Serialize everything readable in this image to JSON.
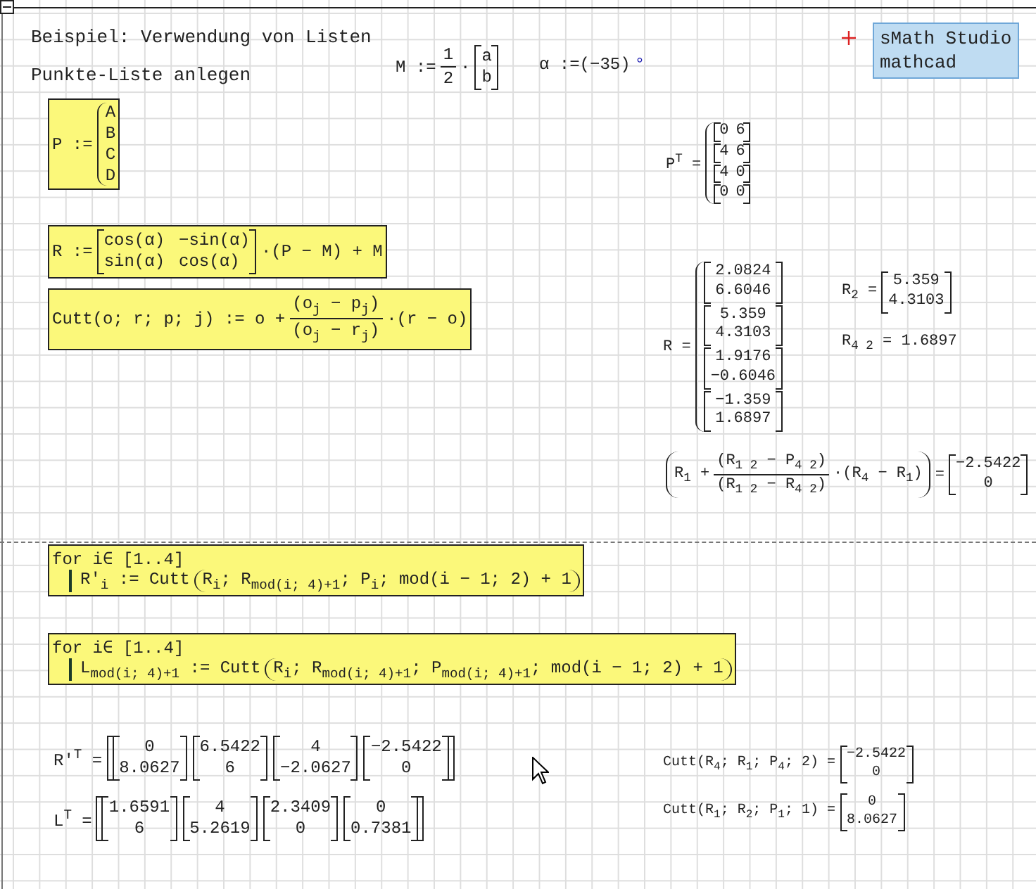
{
  "titles": [
    {
      "text": "Beispiel: Verwendung von Listen"
    },
    {
      "text": "Punkte-Liste anlegen"
    }
  ],
  "label_box": {
    "lines": [
      "sMath Studio",
      "mathcad"
    ]
  },
  "regions": [
    {
      "kind": "expr",
      "highlighted": false,
      "parts": [
        {
          "kind": "text",
          "text": "M :="
        },
        {
          "kind": "frac",
          "num": "1",
          "den": "2"
        },
        {
          "kind": "text",
          "text": "·"
        },
        {
          "kind": "vector",
          "entries": [
            "a",
            "b"
          ]
        }
      ]
    },
    {
      "kind": "expr",
      "highlighted": false,
      "parts": [
        {
          "kind": "text",
          "text": "α :=(−35)"
        },
        {
          "kind": "unit",
          "text": "°"
        }
      ]
    },
    {
      "kind": "expr",
      "highlighted": true,
      "parts": [
        {
          "kind": "text",
          "text": "P :="
        },
        {
          "kind": "brace",
          "items": [
            {
              "kind": "text",
              "text": "A"
            },
            {
              "kind": "text",
              "text": "B"
            },
            {
              "kind": "text",
              "text": "C"
            },
            {
              "kind": "text",
              "text": "D"
            }
          ]
        }
      ]
    },
    {
      "kind": "expr",
      "highlighted": false,
      "parts": [
        {
          "kind": "text",
          "text": "P$^{T}$ ="
        },
        {
          "kind": "brace",
          "items": [
            {
              "kind": "row",
              "entries": [
                "0",
                "6"
              ]
            },
            {
              "kind": "row",
              "entries": [
                "4",
                "6"
              ]
            },
            {
              "kind": "row",
              "entries": [
                "4",
                "0"
              ]
            },
            {
              "kind": "row",
              "entries": [
                "0",
                "0"
              ]
            }
          ]
        }
      ]
    },
    {
      "kind": "expr",
      "highlighted": true,
      "parts": [
        {
          "kind": "text",
          "text": "R :="
        },
        {
          "kind": "matrix",
          "rows": [
            [
              "cos(α)",
              "−sin(α)"
            ],
            [
              "sin(α)",
              "cos(α)"
            ]
          ]
        },
        {
          "kind": "text",
          "text": "·(P − M) + M"
        }
      ]
    },
    {
      "kind": "expr",
      "highlighted": true,
      "parts": [
        {
          "kind": "text",
          "text": "Cutt(o; r; p; j) := o +"
        },
        {
          "kind": "frac",
          "num": "(o$_{j}$ − p$_{j}$)",
          "den": "(o$_{j}$ − r$_{j}$)"
        },
        {
          "kind": "text",
          "text": "·(r − o)"
        }
      ]
    },
    {
      "kind": "expr",
      "highlighted": false,
      "parts": [
        {
          "kind": "text",
          "text": "R ="
        },
        {
          "kind": "brace",
          "items": [
            {
              "kind": "vector",
              "entries": [
                "2.0824",
                "6.6046"
              ]
            },
            {
              "kind": "vector",
              "entries": [
                "5.359",
                "4.3103"
              ]
            },
            {
              "kind": "vector",
              "entries": [
                "1.9176",
                "−0.6046"
              ]
            },
            {
              "kind": "vector",
              "entries": [
                "−1.359",
                "1.6897"
              ]
            }
          ]
        }
      ]
    },
    {
      "kind": "expr",
      "highlighted": false,
      "parts": [
        {
          "kind": "text",
          "text": "R$_{2}$ ="
        },
        {
          "kind": "vector",
          "entries": [
            "5.359",
            "4.3103"
          ]
        }
      ]
    },
    {
      "kind": "expr",
      "highlighted": false,
      "parts": [
        {
          "kind": "text",
          "text": "R$_{4 2}$ = 1.6897"
        }
      ]
    },
    {
      "kind": "expr",
      "highlighted": false,
      "parts": [
        {
          "kind": "paren",
          "parts": [
            {
              "kind": "text",
              "text": "R$_{1}$ +"
            },
            {
              "kind": "frac",
              "num": "(R$_{1 2}$ − P$_{4 2}$)",
              "den": "(R$_{1 2}$ − R$_{4 2}$)"
            },
            {
              "kind": "text",
              "text": "·(R$_{4}$ − R$_{1}$)"
            }
          ]
        },
        {
          "kind": "text",
          "text": "="
        },
        {
          "kind": "vector",
          "entries": [
            "−2.5422",
            "0"
          ]
        }
      ]
    },
    {
      "kind": "loop",
      "highlighted": true,
      "header": "for i∈ [1..4]",
      "body": [
        {
          "kind": "text",
          "text": "R'$_{i}$ := Cutt"
        },
        {
          "kind": "paren",
          "parts": [
            {
              "kind": "text",
              "text": "R$_{i}$; R$_{mod(i; 4)+1}$; P$_{i}$; mod(i − 1; 2) + 1"
            }
          ]
        }
      ]
    },
    {
      "kind": "loop",
      "highlighted": true,
      "header": "for i∈ [1..4]",
      "body": [
        {
          "kind": "text",
          "text": "L$_{mod(i; 4)+1}$ := Cutt"
        },
        {
          "kind": "paren",
          "parts": [
            {
              "kind": "text",
              "text": "R$_{i}$; R$_{mod(i; 4)+1}$; P$_{mod(i; 4)+1}$; mod(i − 1; 2) + 1"
            }
          ]
        }
      ]
    },
    {
      "kind": "expr",
      "highlighted": false,
      "parts": [
        {
          "kind": "text",
          "text": "R'$^{T}$ ="
        },
        {
          "kind": "bracket",
          "parts": [
            {
              "kind": "vector",
              "entries": [
                "0",
                "8.0627"
              ]
            },
            {
              "kind": "vector",
              "entries": [
                "6.5422",
                "6"
              ]
            },
            {
              "kind": "vector",
              "entries": [
                "4",
                "−2.0627"
              ]
            },
            {
              "kind": "vector",
              "entries": [
                "−2.5422",
                "0"
              ]
            }
          ]
        }
      ]
    },
    {
      "kind": "expr",
      "highlighted": false,
      "parts": [
        {
          "kind": "text",
          "text": "L$^{T}$ ="
        },
        {
          "kind": "bracket",
          "parts": [
            {
              "kind": "vector",
              "entries": [
                "1.6591",
                "6"
              ]
            },
            {
              "kind": "vector",
              "entries": [
                "4",
                "5.2619"
              ]
            },
            {
              "kind": "vector",
              "entries": [
                "2.3409",
                "0"
              ]
            },
            {
              "kind": "vector",
              "entries": [
                "0",
                "0.7381"
              ]
            }
          ]
        }
      ]
    },
    {
      "kind": "expr",
      "highlighted": false,
      "parts": [
        {
          "kind": "text",
          "text": "Cutt(R$_{4}$; R$_{1}$; P$_{4}$; 2) ="
        },
        {
          "kind": "vector",
          "entries": [
            "−2.5422",
            "0"
          ]
        }
      ]
    },
    {
      "kind": "expr",
      "highlighted": false,
      "parts": [
        {
          "kind": "text",
          "text": "Cutt(R$_{1}$; R$_{2}$; P$_{1}$; 1) ="
        },
        {
          "kind": "vector",
          "entries": [
            "0",
            "8.0627"
          ]
        }
      ]
    }
  ]
}
